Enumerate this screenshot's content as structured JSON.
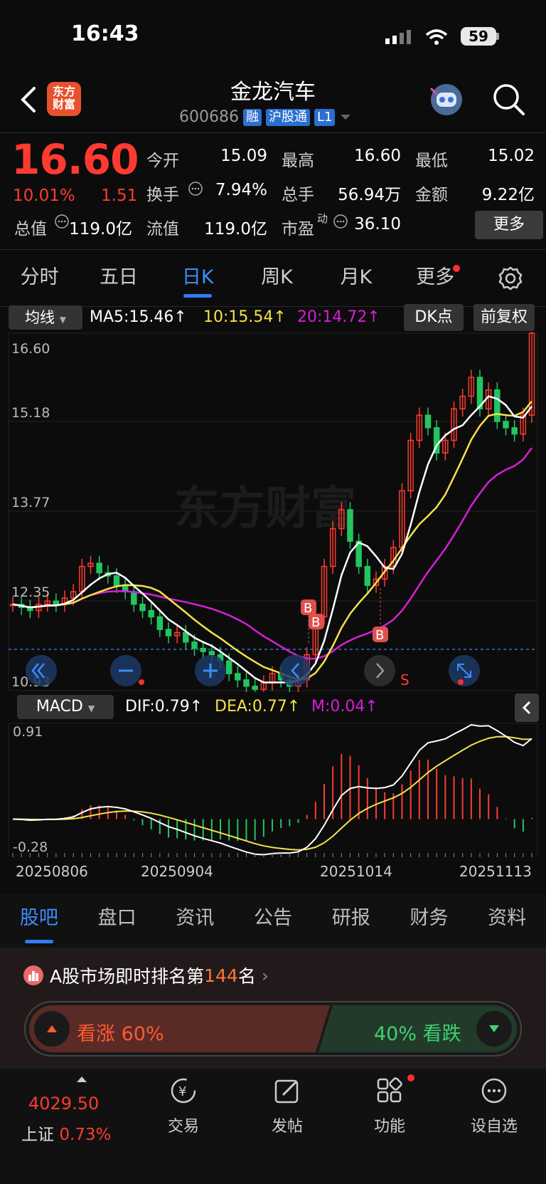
{
  "status_bar": {
    "time": "16:43",
    "battery": "59"
  },
  "header": {
    "title": "金龙汽车",
    "code": "600686",
    "tags": [
      "融",
      "沪股通",
      "L1"
    ],
    "logo_line1": "东方",
    "logo_line2": "财富"
  },
  "quote": {
    "price": "16.60",
    "change_pct": "10.01%",
    "change_amt": "1.51",
    "open_label": "今开",
    "open": "15.09",
    "high_label": "最高",
    "high": "16.60",
    "low_label": "最低",
    "low": "15.02",
    "turnover_label": "换手",
    "turnover": "7.94%",
    "volume_label": "总手",
    "volume": "56.94万",
    "amount_label": "金额",
    "amount": "9.22亿",
    "mcap_label": "总值",
    "mcap": "119.0亿",
    "float_label": "流值",
    "float": "119.0亿",
    "pe_label": "市盈",
    "pe_super": "动",
    "pe": "36.10",
    "more_label": "更多"
  },
  "chart_tabs": [
    "分时",
    "五日",
    "日K",
    "周K",
    "月K",
    "更多"
  ],
  "kline_bar": {
    "indicator": "均线",
    "ma5": "MA5:15.46",
    "ma10": "10:15.54",
    "ma20": "20:14.72",
    "dk": "DK点",
    "adjust": "前复权"
  },
  "price_axis": [
    "16.60",
    "15.18",
    "13.77",
    "12.35",
    "10.93"
  ],
  "watermark": "东方财富",
  "macd_bar": {
    "indicator": "MACD",
    "dif": "DIF:0.79",
    "dea": "DEA:0.77",
    "m": "M:0.04"
  },
  "macd_axis": [
    "0.91",
    "-0.28"
  ],
  "dates": [
    "20250806",
    "20250904",
    "20251014",
    "20251113"
  ],
  "info_tabs": [
    "股吧",
    "盘口",
    "资讯",
    "公告",
    "研报",
    "财务",
    "资料"
  ],
  "ranking": {
    "prefix": "A股市场即时排名第",
    "rank": "144",
    "suffix": "名"
  },
  "sentiment": {
    "up_label": "看涨",
    "up_pct": "60%",
    "down_pct": "40%",
    "down_label": "看跌"
  },
  "bottom_nav": {
    "index_value": "4029.50",
    "index_name": "上证",
    "index_pct": "0.73%",
    "items": [
      "交易",
      "发帖",
      "功能",
      "设自选"
    ]
  },
  "colors": {
    "up": "#ff3b30",
    "down": "#22c55e",
    "accent": "#2f7df6",
    "ma5": "#ffffff",
    "ma10": "#f5e14a",
    "ma20": "#d61fd6"
  },
  "markers": [
    "B",
    "B",
    "B",
    "S"
  ]
}
